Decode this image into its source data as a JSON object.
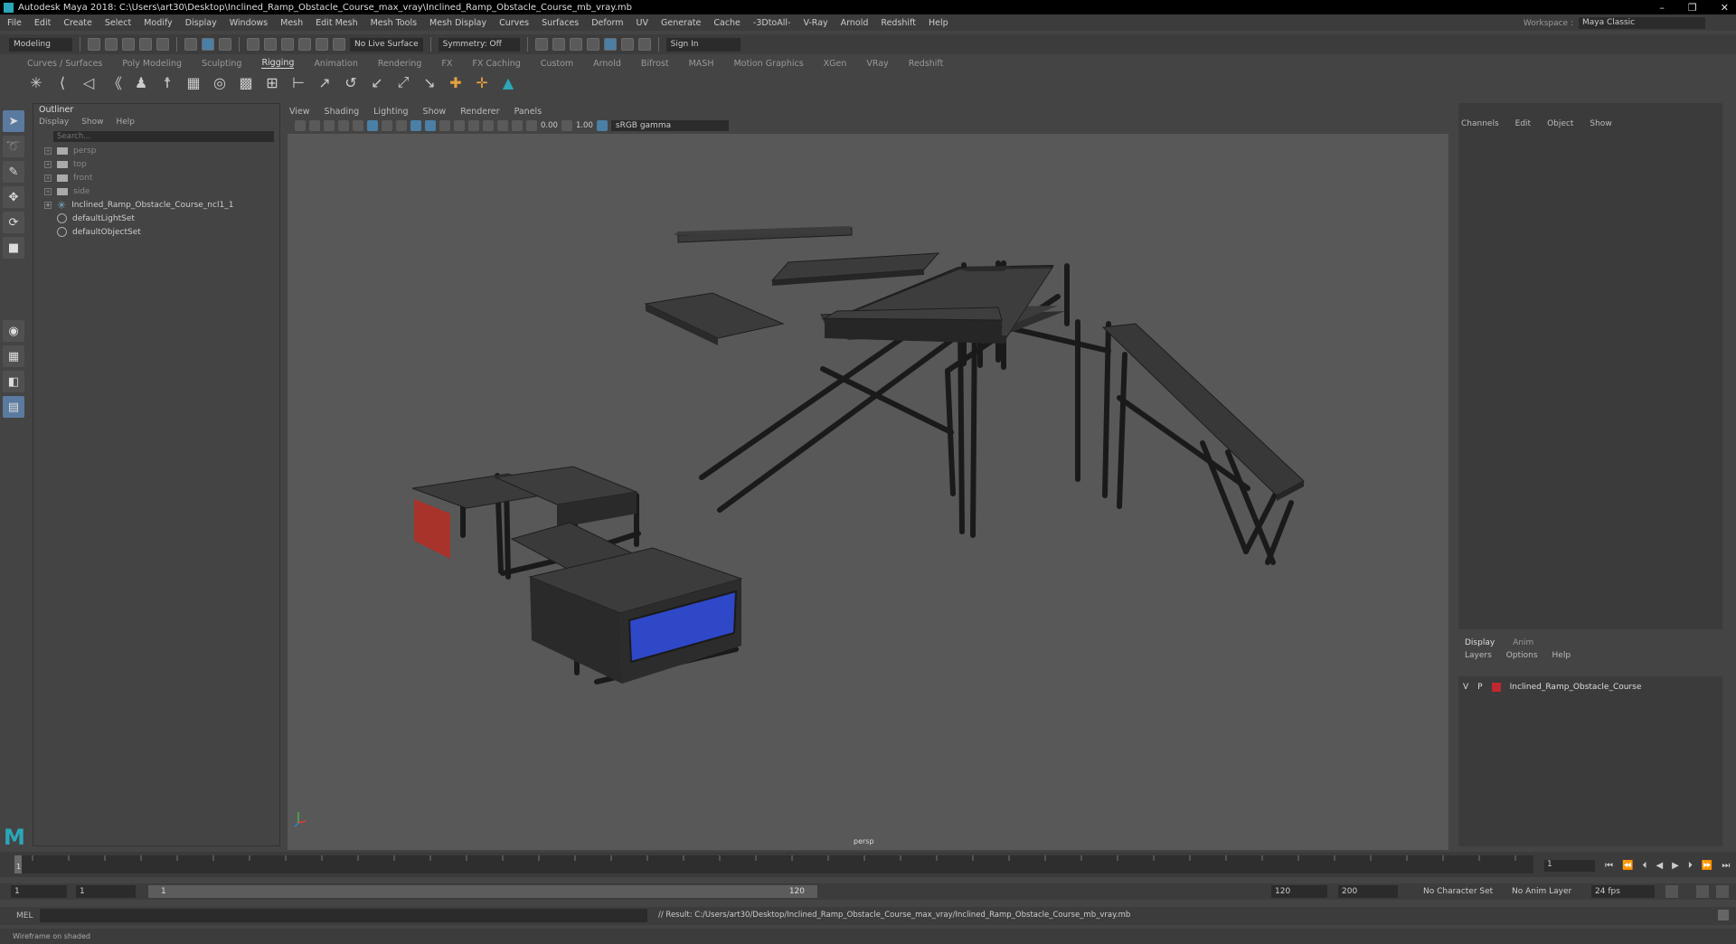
{
  "window": {
    "title": "Autodesk Maya 2018: C:\\Users\\art30\\Desktop\\Inclined_Ramp_Obstacle_Course_max_vray\\Inclined_Ramp_Obstacle_Course_mb_vray.mb",
    "controls": [
      "–",
      "❐",
      "✕"
    ]
  },
  "menubar": {
    "items": [
      "File",
      "Edit",
      "Create",
      "Select",
      "Modify",
      "Display",
      "Windows",
      "Mesh",
      "Edit Mesh",
      "Mesh Tools",
      "Mesh Display",
      "Curves",
      "Surfaces",
      "Deform",
      "UV",
      "Generate",
      "Cache",
      "-3DtoAll-",
      "V-Ray",
      "Arnold",
      "Redshift",
      "Help"
    ],
    "workspace_label": "Workspace :",
    "workspace_value": "Maya Classic"
  },
  "statusline": {
    "mode": "Modeling",
    "live_surface": "No Live Surface",
    "symmetry": "Symmetry: Off",
    "sign_in": "Sign In"
  },
  "shelf": {
    "tabs": [
      "Curves / Surfaces",
      "Poly Modeling",
      "Sculpting",
      "Rigging",
      "Animation",
      "Rendering",
      "FX",
      "FX Caching",
      "Custom",
      "Arnold",
      "Bifrost",
      "MASH",
      "Motion Graphics",
      "XGen",
      "VRay",
      "Redshift"
    ],
    "active_tab": "Rigging"
  },
  "outliner": {
    "title": "Outliner",
    "menu": [
      "Display",
      "Show",
      "Help"
    ],
    "search_placeholder": "Search...",
    "items": [
      {
        "label": "persp",
        "kind": "camera"
      },
      {
        "label": "top",
        "kind": "camera"
      },
      {
        "label": "front",
        "kind": "camera"
      },
      {
        "label": "side",
        "kind": "camera"
      },
      {
        "label": "Inclined_Ramp_Obstacle_Course_ncl1_1",
        "kind": "group"
      },
      {
        "label": "defaultLightSet",
        "kind": "set"
      },
      {
        "label": "defaultObjectSet",
        "kind": "set"
      }
    ]
  },
  "viewport": {
    "menu": [
      "View",
      "Shading",
      "Lighting",
      "Show",
      "Renderer",
      "Panels"
    ],
    "exposure": "0.00",
    "gamma": "1.00",
    "colorspace": "sRGB gamma",
    "camera_label": "persp"
  },
  "channelbox": {
    "menu": [
      "Channels",
      "Edit",
      "Object",
      "Show"
    ]
  },
  "layers": {
    "tabs": [
      "Display",
      "Anim"
    ],
    "active_tab": "Display",
    "menu": [
      "Layers",
      "Options",
      "Help"
    ],
    "rows": [
      {
        "v": "V",
        "p": "P",
        "name": "Inclined_Ramp_Obstacle_Course",
        "color": "#c0282f"
      }
    ]
  },
  "timeline": {
    "current_frame": "1",
    "start_label": "1"
  },
  "range": {
    "start": "1",
    "playback_start": "1",
    "slider_start": "1",
    "slider_end": "120",
    "playback_end": "120",
    "end": "200",
    "character_set": "No Character Set",
    "anim_layer": "No Anim Layer",
    "fps": "24 fps"
  },
  "command": {
    "label": "MEL",
    "result": "// Result: C:/Users/art30/Desktop/Inclined_Ramp_Obstacle_Course_max_vray/Inclined_Ramp_Obstacle_Course_mb_vray.mb"
  },
  "helpline": "Wireframe on shaded",
  "colors": {
    "accent": "#2aa7b8",
    "selection": "#5a7aa0",
    "red_panel": "#b33a2a",
    "blue_panel": "#2f48c8"
  }
}
